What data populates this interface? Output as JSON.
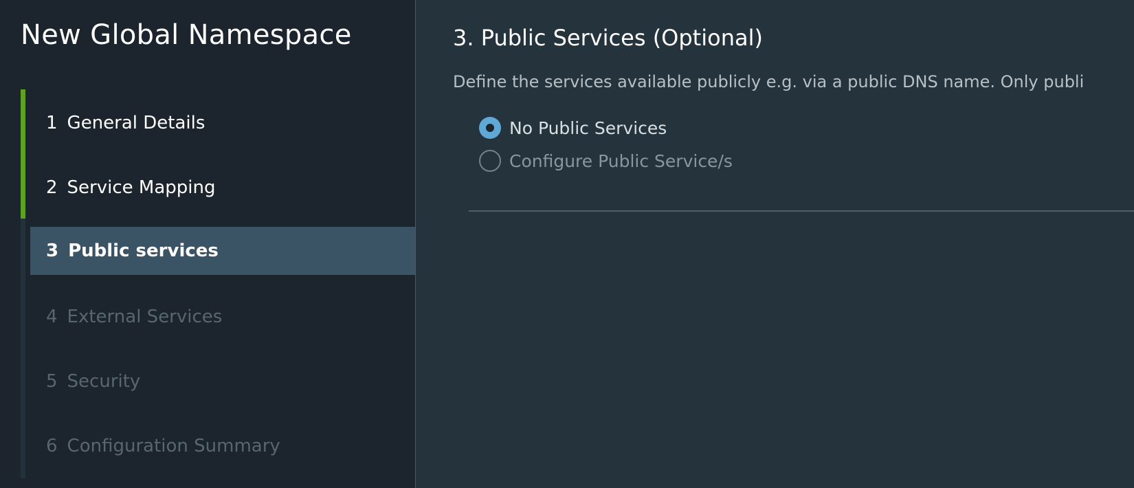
{
  "wizard": {
    "title": "New Global Namespace",
    "steps": [
      {
        "number": "1",
        "label": "General Details",
        "state": "done"
      },
      {
        "number": "2",
        "label": "Service Mapping",
        "state": "done"
      },
      {
        "number": "3",
        "label": "Public services",
        "state": "current"
      },
      {
        "number": "4",
        "label": "External Services",
        "state": "pending"
      },
      {
        "number": "5",
        "label": "Security",
        "state": "pending"
      },
      {
        "number": "6",
        "label": "Configuration Summary",
        "state": "pending"
      }
    ]
  },
  "page": {
    "title": "3. Public Services (Optional)",
    "description": "Define the services available publicly e.g. via a public DNS name. Only publi",
    "options": [
      {
        "label": "No Public Services",
        "selected": true
      },
      {
        "label": "Configure Public Service/s",
        "selected": false
      }
    ]
  },
  "colors": {
    "sidebar_bg": "#1c252d",
    "main_bg": "#25333d",
    "progress_complete": "#5aa220",
    "current_step_bg": "#3b5465",
    "radio_checked": "#60a8d6"
  }
}
